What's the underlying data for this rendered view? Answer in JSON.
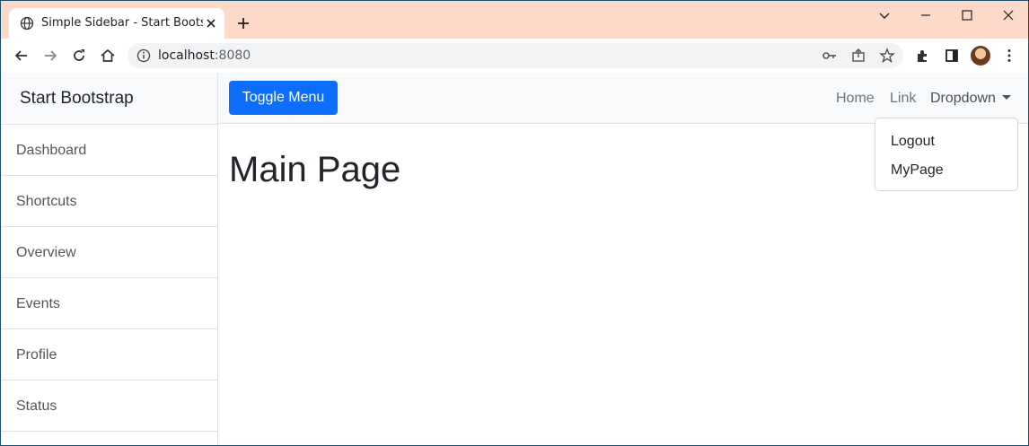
{
  "browser": {
    "tab_title": "Simple Sidebar - Start Bootstrap",
    "url_host": "localhost",
    "url_port": ":8080"
  },
  "sidebar": {
    "heading": "Start Bootstrap",
    "items": [
      {
        "label": "Dashboard"
      },
      {
        "label": "Shortcuts"
      },
      {
        "label": "Overview"
      },
      {
        "label": "Events"
      },
      {
        "label": "Profile"
      },
      {
        "label": "Status"
      }
    ]
  },
  "navbar": {
    "toggle_label": "Toggle Menu",
    "links": {
      "home": "Home",
      "link": "Link",
      "dropdown": "Dropdown"
    },
    "dropdown_items": [
      "Logout",
      "MyPage"
    ]
  },
  "main": {
    "title": "Main Page"
  },
  "colors": {
    "primary": "#0d6efd",
    "titlebar": "#fcd9c8"
  }
}
